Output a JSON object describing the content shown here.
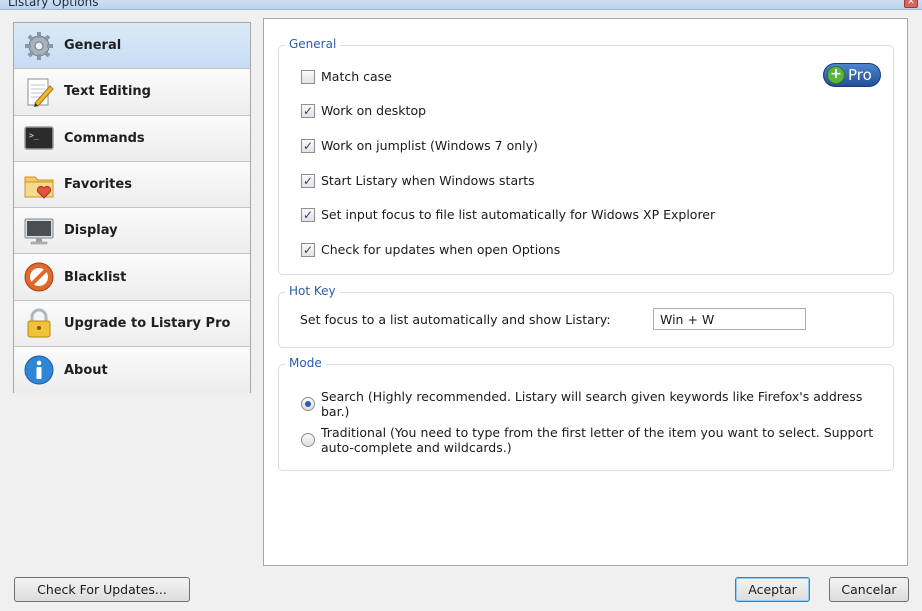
{
  "window": {
    "title": "Listary Options"
  },
  "sidebar": {
    "items": [
      {
        "label": "General",
        "icon": "gear-icon",
        "active": true
      },
      {
        "label": "Text Editing",
        "icon": "notepad-pencil-icon",
        "active": false
      },
      {
        "label": "Commands",
        "icon": "terminal-icon",
        "active": false
      },
      {
        "label": "Favorites",
        "icon": "folder-heart-icon",
        "active": false
      },
      {
        "label": "Display",
        "icon": "monitor-icon",
        "active": false
      },
      {
        "label": "Blacklist",
        "icon": "prohibited-icon",
        "active": false
      },
      {
        "label": "Upgrade to Listary Pro",
        "icon": "padlock-icon",
        "active": false
      },
      {
        "label": "About",
        "icon": "info-icon",
        "active": false
      }
    ]
  },
  "general": {
    "legend": "General",
    "pro_badge": "Pro",
    "options": [
      {
        "label": "Match case",
        "checked": false
      },
      {
        "label": "Work on desktop",
        "checked": true
      },
      {
        "label": "Work on jumplist (Windows 7 only)",
        "checked": true
      },
      {
        "label": "Start Listary when Windows starts",
        "checked": true
      },
      {
        "label": "Set input focus to file list automatically for Widows XP Explorer",
        "checked": true
      },
      {
        "label": "Check for updates when open Options",
        "checked": true
      }
    ]
  },
  "hotkey": {
    "legend": "Hot Key",
    "label": "Set focus to a list automatically and show Listary:",
    "value": "Win + W"
  },
  "mode": {
    "legend": "Mode",
    "options": [
      {
        "label": "Search (Highly recommended. Listary will search given keywords like Firefox's address bar.)",
        "selected": true
      },
      {
        "label_line1": "Traditional (You need to type from the first letter of the item you want to select.  Support",
        "label_line2": "auto-complete and wildcards.)",
        "selected": false
      }
    ]
  },
  "footer": {
    "check_updates": "Check For Updates...",
    "accept": "Aceptar",
    "cancel": "Cancelar"
  },
  "colors": {
    "legend_blue": "#2a5db0",
    "active_item": "#c6dcf3",
    "pro_badge": "#234f98"
  }
}
